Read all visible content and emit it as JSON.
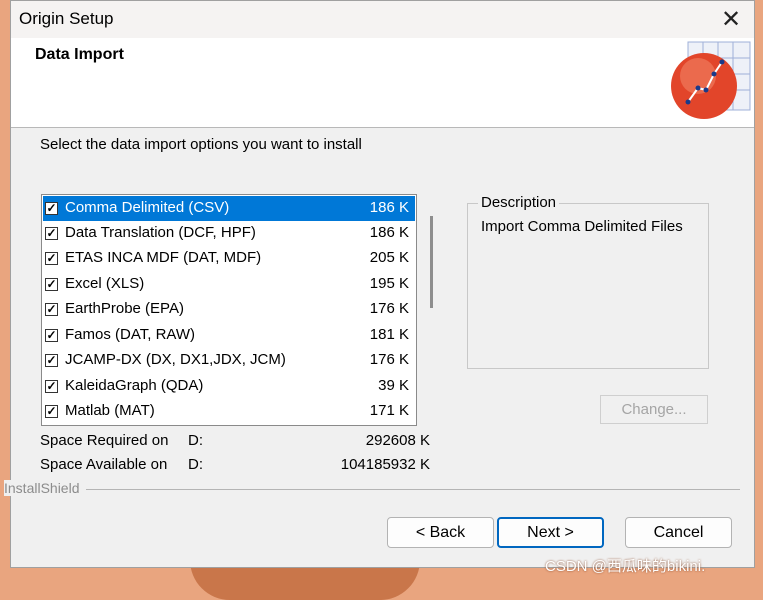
{
  "window": {
    "title": "Origin Setup"
  },
  "header": {
    "title": "Data Import"
  },
  "instruction": "Select the data import options you want to install",
  "components": [
    {
      "label": "Comma Delimited (CSV)",
      "size": "186 K",
      "checked": true,
      "selected": true
    },
    {
      "label": "Data Translation (DCF, HPF)",
      "size": "186 K",
      "checked": true,
      "selected": false
    },
    {
      "label": "ETAS INCA MDF (DAT, MDF)",
      "size": "205 K",
      "checked": true,
      "selected": false
    },
    {
      "label": "Excel (XLS)",
      "size": "195 K",
      "checked": true,
      "selected": false
    },
    {
      "label": "EarthProbe (EPA)",
      "size": "176 K",
      "checked": true,
      "selected": false
    },
    {
      "label": "Famos (DAT, RAW)",
      "size": "181 K",
      "checked": true,
      "selected": false
    },
    {
      "label": "JCAMP-DX (DX, DX1,JDX, JCM)",
      "size": "176 K",
      "checked": true,
      "selected": false
    },
    {
      "label": "KaleidaGraph (QDA)",
      "size": "39 K",
      "checked": true,
      "selected": false
    },
    {
      "label": "Matlab (MAT)",
      "size": "171 K",
      "checked": true,
      "selected": false
    }
  ],
  "space": {
    "required_label": "Space Required on",
    "required_drive": "D:",
    "required_value": "292608 K",
    "available_label": "Space Available on",
    "available_drive": "D:",
    "available_value": "104185932 K"
  },
  "description": {
    "title": "Description",
    "text": "Import Comma Delimited Files"
  },
  "buttons": {
    "change": "Change...",
    "back": "< Back",
    "next": "Next >",
    "cancel": "Cancel"
  },
  "branding": "InstallShield",
  "watermark": "CSDN @西瓜味的bikini.",
  "colors": {
    "selection": "#0078d7",
    "default_button_border": "#0067c0",
    "logo_red": "#e2452a"
  },
  "icons": {
    "close": "close-icon",
    "logo": "origin-logo-icon",
    "check": "checkmark-icon"
  }
}
